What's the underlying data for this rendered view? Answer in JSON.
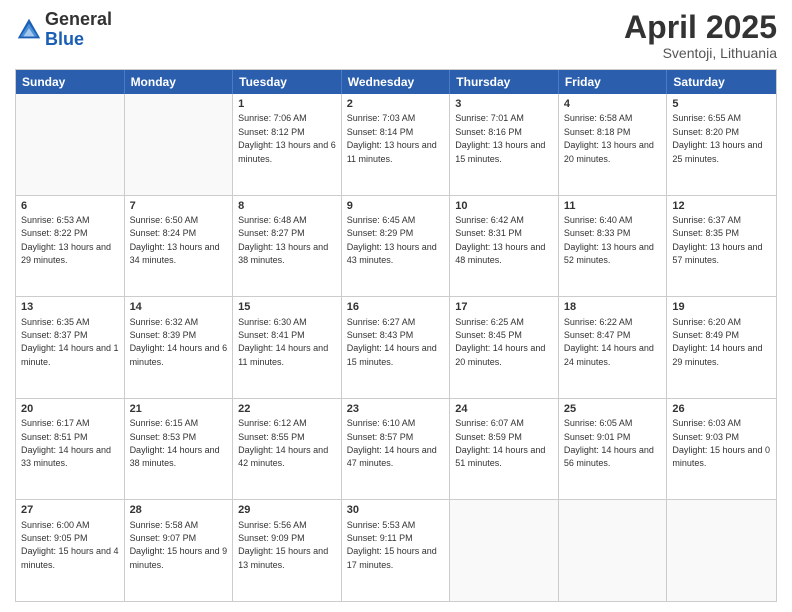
{
  "logo": {
    "general": "General",
    "blue": "Blue"
  },
  "title": "April 2025",
  "subtitle": "Sventoji, Lithuania",
  "header_days": [
    "Sunday",
    "Monday",
    "Tuesday",
    "Wednesday",
    "Thursday",
    "Friday",
    "Saturday"
  ],
  "weeks": [
    [
      {
        "day": "",
        "text": ""
      },
      {
        "day": "",
        "text": ""
      },
      {
        "day": "1",
        "text": "Sunrise: 7:06 AM\nSunset: 8:12 PM\nDaylight: 13 hours and 6 minutes."
      },
      {
        "day": "2",
        "text": "Sunrise: 7:03 AM\nSunset: 8:14 PM\nDaylight: 13 hours and 11 minutes."
      },
      {
        "day": "3",
        "text": "Sunrise: 7:01 AM\nSunset: 8:16 PM\nDaylight: 13 hours and 15 minutes."
      },
      {
        "day": "4",
        "text": "Sunrise: 6:58 AM\nSunset: 8:18 PM\nDaylight: 13 hours and 20 minutes."
      },
      {
        "day": "5",
        "text": "Sunrise: 6:55 AM\nSunset: 8:20 PM\nDaylight: 13 hours and 25 minutes."
      }
    ],
    [
      {
        "day": "6",
        "text": "Sunrise: 6:53 AM\nSunset: 8:22 PM\nDaylight: 13 hours and 29 minutes."
      },
      {
        "day": "7",
        "text": "Sunrise: 6:50 AM\nSunset: 8:24 PM\nDaylight: 13 hours and 34 minutes."
      },
      {
        "day": "8",
        "text": "Sunrise: 6:48 AM\nSunset: 8:27 PM\nDaylight: 13 hours and 38 minutes."
      },
      {
        "day": "9",
        "text": "Sunrise: 6:45 AM\nSunset: 8:29 PM\nDaylight: 13 hours and 43 minutes."
      },
      {
        "day": "10",
        "text": "Sunrise: 6:42 AM\nSunset: 8:31 PM\nDaylight: 13 hours and 48 minutes."
      },
      {
        "day": "11",
        "text": "Sunrise: 6:40 AM\nSunset: 8:33 PM\nDaylight: 13 hours and 52 minutes."
      },
      {
        "day": "12",
        "text": "Sunrise: 6:37 AM\nSunset: 8:35 PM\nDaylight: 13 hours and 57 minutes."
      }
    ],
    [
      {
        "day": "13",
        "text": "Sunrise: 6:35 AM\nSunset: 8:37 PM\nDaylight: 14 hours and 1 minute."
      },
      {
        "day": "14",
        "text": "Sunrise: 6:32 AM\nSunset: 8:39 PM\nDaylight: 14 hours and 6 minutes."
      },
      {
        "day": "15",
        "text": "Sunrise: 6:30 AM\nSunset: 8:41 PM\nDaylight: 14 hours and 11 minutes."
      },
      {
        "day": "16",
        "text": "Sunrise: 6:27 AM\nSunset: 8:43 PM\nDaylight: 14 hours and 15 minutes."
      },
      {
        "day": "17",
        "text": "Sunrise: 6:25 AM\nSunset: 8:45 PM\nDaylight: 14 hours and 20 minutes."
      },
      {
        "day": "18",
        "text": "Sunrise: 6:22 AM\nSunset: 8:47 PM\nDaylight: 14 hours and 24 minutes."
      },
      {
        "day": "19",
        "text": "Sunrise: 6:20 AM\nSunset: 8:49 PM\nDaylight: 14 hours and 29 minutes."
      }
    ],
    [
      {
        "day": "20",
        "text": "Sunrise: 6:17 AM\nSunset: 8:51 PM\nDaylight: 14 hours and 33 minutes."
      },
      {
        "day": "21",
        "text": "Sunrise: 6:15 AM\nSunset: 8:53 PM\nDaylight: 14 hours and 38 minutes."
      },
      {
        "day": "22",
        "text": "Sunrise: 6:12 AM\nSunset: 8:55 PM\nDaylight: 14 hours and 42 minutes."
      },
      {
        "day": "23",
        "text": "Sunrise: 6:10 AM\nSunset: 8:57 PM\nDaylight: 14 hours and 47 minutes."
      },
      {
        "day": "24",
        "text": "Sunrise: 6:07 AM\nSunset: 8:59 PM\nDaylight: 14 hours and 51 minutes."
      },
      {
        "day": "25",
        "text": "Sunrise: 6:05 AM\nSunset: 9:01 PM\nDaylight: 14 hours and 56 minutes."
      },
      {
        "day": "26",
        "text": "Sunrise: 6:03 AM\nSunset: 9:03 PM\nDaylight: 15 hours and 0 minutes."
      }
    ],
    [
      {
        "day": "27",
        "text": "Sunrise: 6:00 AM\nSunset: 9:05 PM\nDaylight: 15 hours and 4 minutes."
      },
      {
        "day": "28",
        "text": "Sunrise: 5:58 AM\nSunset: 9:07 PM\nDaylight: 15 hours and 9 minutes."
      },
      {
        "day": "29",
        "text": "Sunrise: 5:56 AM\nSunset: 9:09 PM\nDaylight: 15 hours and 13 minutes."
      },
      {
        "day": "30",
        "text": "Sunrise: 5:53 AM\nSunset: 9:11 PM\nDaylight: 15 hours and 17 minutes."
      },
      {
        "day": "",
        "text": ""
      },
      {
        "day": "",
        "text": ""
      },
      {
        "day": "",
        "text": ""
      }
    ]
  ]
}
